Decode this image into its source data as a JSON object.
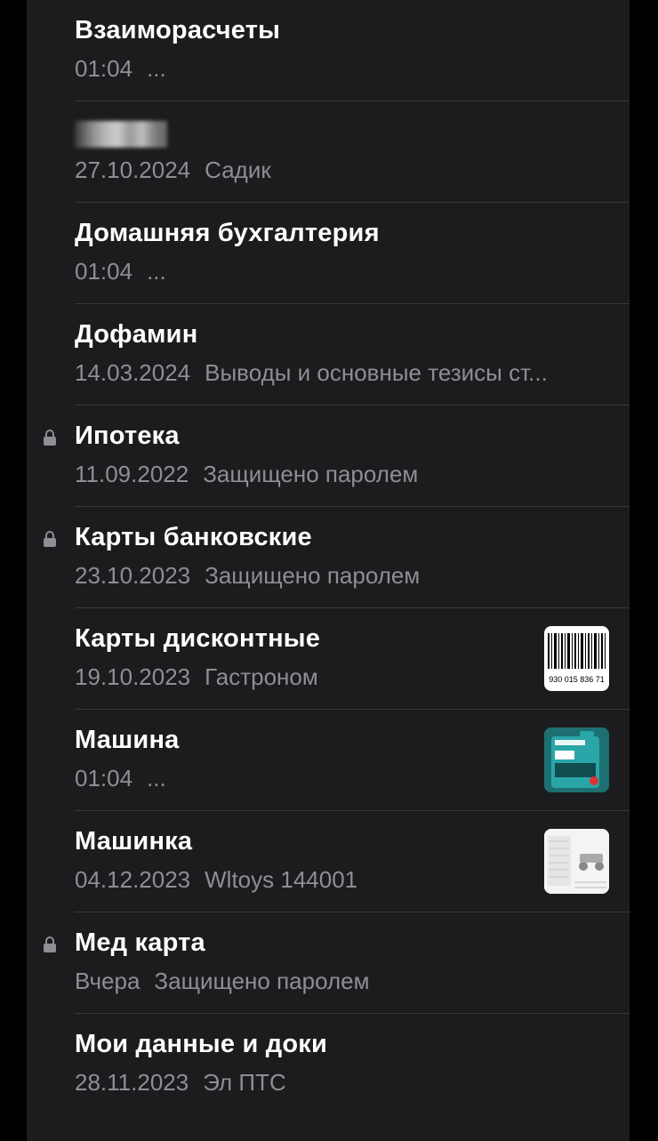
{
  "notes": [
    {
      "title": "Взаиморасчеты",
      "date": "01:04",
      "preview": "...",
      "locked": false
    },
    {
      "title": "",
      "title_redacted": true,
      "date": "27.10.2024",
      "preview": "Садик",
      "locked": false
    },
    {
      "title": "Домашняя бухгалтерия",
      "date": "01:04",
      "preview": "...",
      "locked": false
    },
    {
      "title": "Дофамин",
      "date": "14.03.2024",
      "preview": "Выводы и основные тезисы ст...",
      "locked": false
    },
    {
      "title": "Ипотека",
      "date": "11.09.2022",
      "preview": "Защищено паролем",
      "locked": true
    },
    {
      "title": "Карты банковские",
      "date": "23.10.2023",
      "preview": "Защищено паролем",
      "locked": true
    },
    {
      "title": "Карты дисконтные",
      "date": "19.10.2023",
      "preview": "Гастроном",
      "locked": false,
      "thumbnail": {
        "type": "barcode",
        "text": "930 015 836 71"
      }
    },
    {
      "title": "Машина",
      "date": "01:04",
      "preview": "...",
      "locked": false,
      "thumbnail": {
        "type": "oil-can"
      }
    },
    {
      "title": "Машинка",
      "date": "04.12.2023",
      "preview": "Wltoys 144001",
      "locked": false,
      "thumbnail": {
        "type": "rc-car-manual"
      }
    },
    {
      "title": "Мед карта",
      "date": "Вчера",
      "preview": "Защищено паролем",
      "locked": true
    },
    {
      "title": "Мои данные и доки",
      "date": "28.11.2023",
      "preview": "Эл ПТС",
      "locked": false
    }
  ],
  "colors": {
    "background": "#000000",
    "panel": "#1c1c1e",
    "title": "#ffffff",
    "subtitle": "#8e8e93",
    "divider": "#38383a",
    "lock": "#8e8e93"
  }
}
